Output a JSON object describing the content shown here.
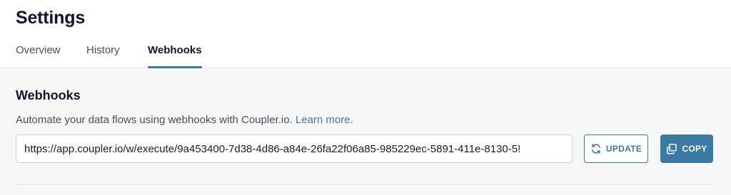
{
  "header": {
    "title": "Settings",
    "tabs": [
      {
        "label": "Overview",
        "active": false
      },
      {
        "label": "History",
        "active": false
      },
      {
        "label": "Webhooks",
        "active": true
      }
    ]
  },
  "webhooks": {
    "title": "Webhooks",
    "description": "Automate your data flows using webhooks with Coupler.io.",
    "learn_more_label": "Learn more.",
    "url": "https://app.coupler.io/w/execute/9a453400-7d38-4d86-a84e-26fa22f06a85-985229ec-5891-411e-8130-5!",
    "update_label": "UPDATE",
    "update_icon": "refresh-icon",
    "copy_label": "COPY",
    "copy_icon": "copy-icon"
  },
  "colors": {
    "accent": "#3c7aa6",
    "background": "#f7f7f8",
    "header_background": "#ffffff"
  }
}
